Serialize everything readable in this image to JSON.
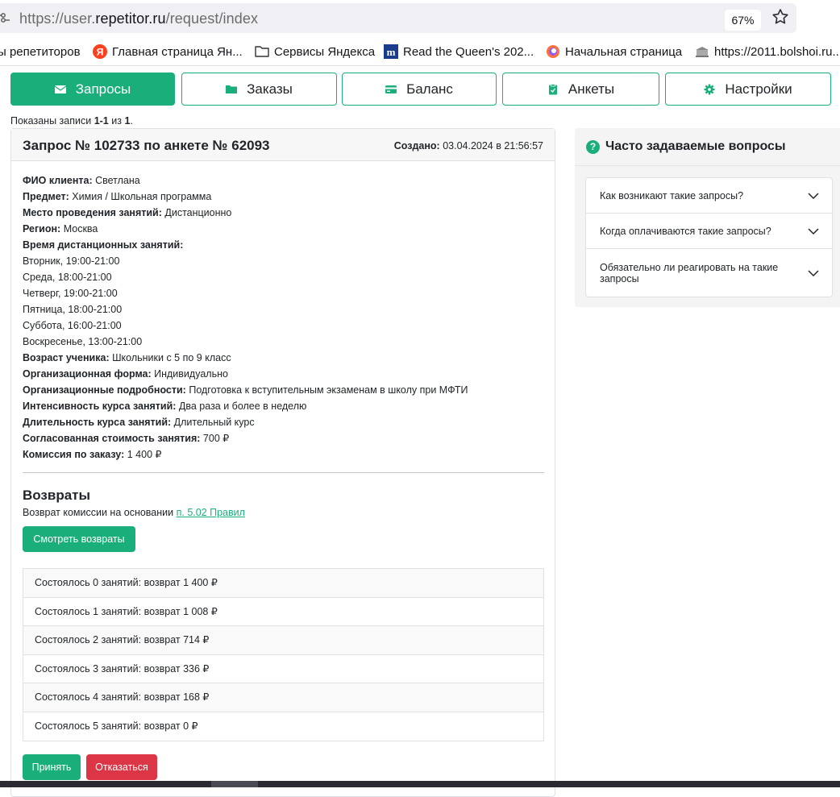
{
  "browser": {
    "url_prefix": "https://user.",
    "url_host": "repetitor.ru",
    "url_path": "/request/index",
    "zoom": "67%"
  },
  "bookmarks": [
    {
      "label": "ы репетиторов",
      "icon": "none"
    },
    {
      "label": "Главная страница Ян...",
      "icon": "yandex-icon"
    },
    {
      "label": "Сервисы Яндекса",
      "icon": "folder-icon"
    },
    {
      "label": "Read the Queen's 202...",
      "icon": "m-logo-icon"
    },
    {
      "label": "Начальная страница",
      "icon": "globe-icon"
    },
    {
      "label": "https://2011.bolshoi.ru...",
      "icon": "building-icon"
    }
  ],
  "nav": [
    {
      "label": "Запросы",
      "icon": "envelope-icon",
      "active": true
    },
    {
      "label": "Заказы",
      "icon": "folder-icon",
      "active": false
    },
    {
      "label": "Баланс",
      "icon": "card-icon",
      "active": false
    },
    {
      "label": "Анкеты",
      "icon": "clipboard-icon",
      "active": false
    },
    {
      "label": "Настройки",
      "icon": "gear-icon",
      "active": false
    }
  ],
  "records_info": {
    "prefix": "Показаны записи ",
    "range": "1-1",
    "of": " из ",
    "total": "1",
    "suffix": "."
  },
  "request": {
    "title": "Запрос № 102733 по анкете № 62093",
    "created_label": "Создано:",
    "created_value": " 03.04.2024 в 21:56:57",
    "fields": [
      {
        "label": "ФИО клиента:",
        "value": " Светлана"
      },
      {
        "label": "Предмет:",
        "value": " Химия / Школьная программа"
      },
      {
        "label": "Место проведения занятий:",
        "value": " Дистанционно"
      },
      {
        "label": "Регион:",
        "value": " Москва"
      },
      {
        "label": "Время дистанционных занятий:",
        "value": ""
      },
      {
        "label": "",
        "value": "Вторник, 19:00-21:00"
      },
      {
        "label": "",
        "value": "Среда, 18:00-21:00"
      },
      {
        "label": "",
        "value": "Четверг, 19:00-21:00"
      },
      {
        "label": "",
        "value": "Пятница, 18:00-21:00"
      },
      {
        "label": "",
        "value": "Суббота, 16:00-21:00"
      },
      {
        "label": "",
        "value": "Воскресенье, 13:00-21:00"
      },
      {
        "label": "Возраст ученика:",
        "value": " Школьники с 5 по 9 класс"
      },
      {
        "label": "Организационная форма:",
        "value": " Индивидуально"
      },
      {
        "label": "Организационные подробности:",
        "value": " Подготовка к вступительным экзаменам в школу при МФТИ"
      },
      {
        "label": "Интенсивность курса занятий:",
        "value": " Два раза и более в неделю"
      },
      {
        "label": "Длительность курса занятий:",
        "value": " Длительный курс"
      },
      {
        "label": "Согласованная стоимость занятия:",
        "value": " 700 ₽"
      },
      {
        "label": "Комиссия по заказу:",
        "value": " 1 400 ₽"
      }
    ],
    "refunds": {
      "title": "Возвраты",
      "basis_text": "Возврат комиссии на основании ",
      "basis_link": "п. 5.02 Правил",
      "view_button": "Смотреть возвраты",
      "items": [
        "Состоялось 0 занятий: возврат 1 400 ₽",
        "Состоялось 1 занятий: возврат 1 008 ₽",
        "Состоялось 2 занятий: возврат 714 ₽",
        "Состоялось 3 занятий: возврат 336 ₽",
        "Состоялось 4 занятий: возврат 168 ₽",
        "Состоялось 5 занятий: возврат 0 ₽"
      ]
    },
    "accept_button": "Принять",
    "decline_button": "Отказаться"
  },
  "faq": {
    "title": "Часто задаваемые вопросы",
    "items": [
      "Как возникают такие запросы?",
      "Когда оплачиваются такие запросы?",
      "Обязательно ли реагировать на такие запросы"
    ]
  },
  "colors": {
    "accent": "#1aaf7a",
    "danger": "#dc3545"
  }
}
